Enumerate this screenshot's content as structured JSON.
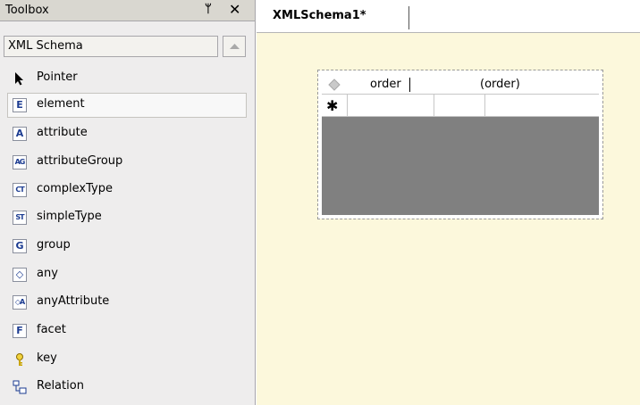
{
  "toolbox": {
    "title": "Toolbox",
    "pin_glyph": "ᛘ",
    "close_glyph": "✕",
    "tab": {
      "label": "XML Schema",
      "scroll_icon": "scroll-up-icon"
    },
    "items": [
      {
        "label": "Pointer",
        "icon": "pointer-icon",
        "glyph": ""
      },
      {
        "label": "element",
        "icon": "element-icon",
        "glyph": "E",
        "selected": true
      },
      {
        "label": "attribute",
        "icon": "attribute-icon",
        "glyph": "A"
      },
      {
        "label": "attributeGroup",
        "icon": "attribute-group-icon",
        "glyph": "AG"
      },
      {
        "label": "complexType",
        "icon": "complex-type-icon",
        "glyph": "CT"
      },
      {
        "label": "simpleType",
        "icon": "simple-type-icon",
        "glyph": "ST"
      },
      {
        "label": "group",
        "icon": "group-icon",
        "glyph": "G"
      },
      {
        "label": "any",
        "icon": "any-icon",
        "glyph": "◇"
      },
      {
        "label": "anyAttribute",
        "icon": "any-attribute-icon",
        "glyph": "◇A"
      },
      {
        "label": "facet",
        "icon": "facet-icon",
        "glyph": "F"
      },
      {
        "label": "key",
        "icon": "key-icon",
        "glyph": ""
      },
      {
        "label": "Relation",
        "icon": "relation-icon",
        "glyph": ""
      }
    ]
  },
  "document": {
    "tab_label": "XMLSchema1*",
    "element": {
      "name": "order",
      "type": "(order)",
      "new_row_glyph": "✱"
    }
  },
  "colors": {
    "designer_bg": "#fcf8dc",
    "toolbox_bg": "#eeeded",
    "icon_blue": "#1b3b91",
    "element_empty_area": "#808080"
  }
}
